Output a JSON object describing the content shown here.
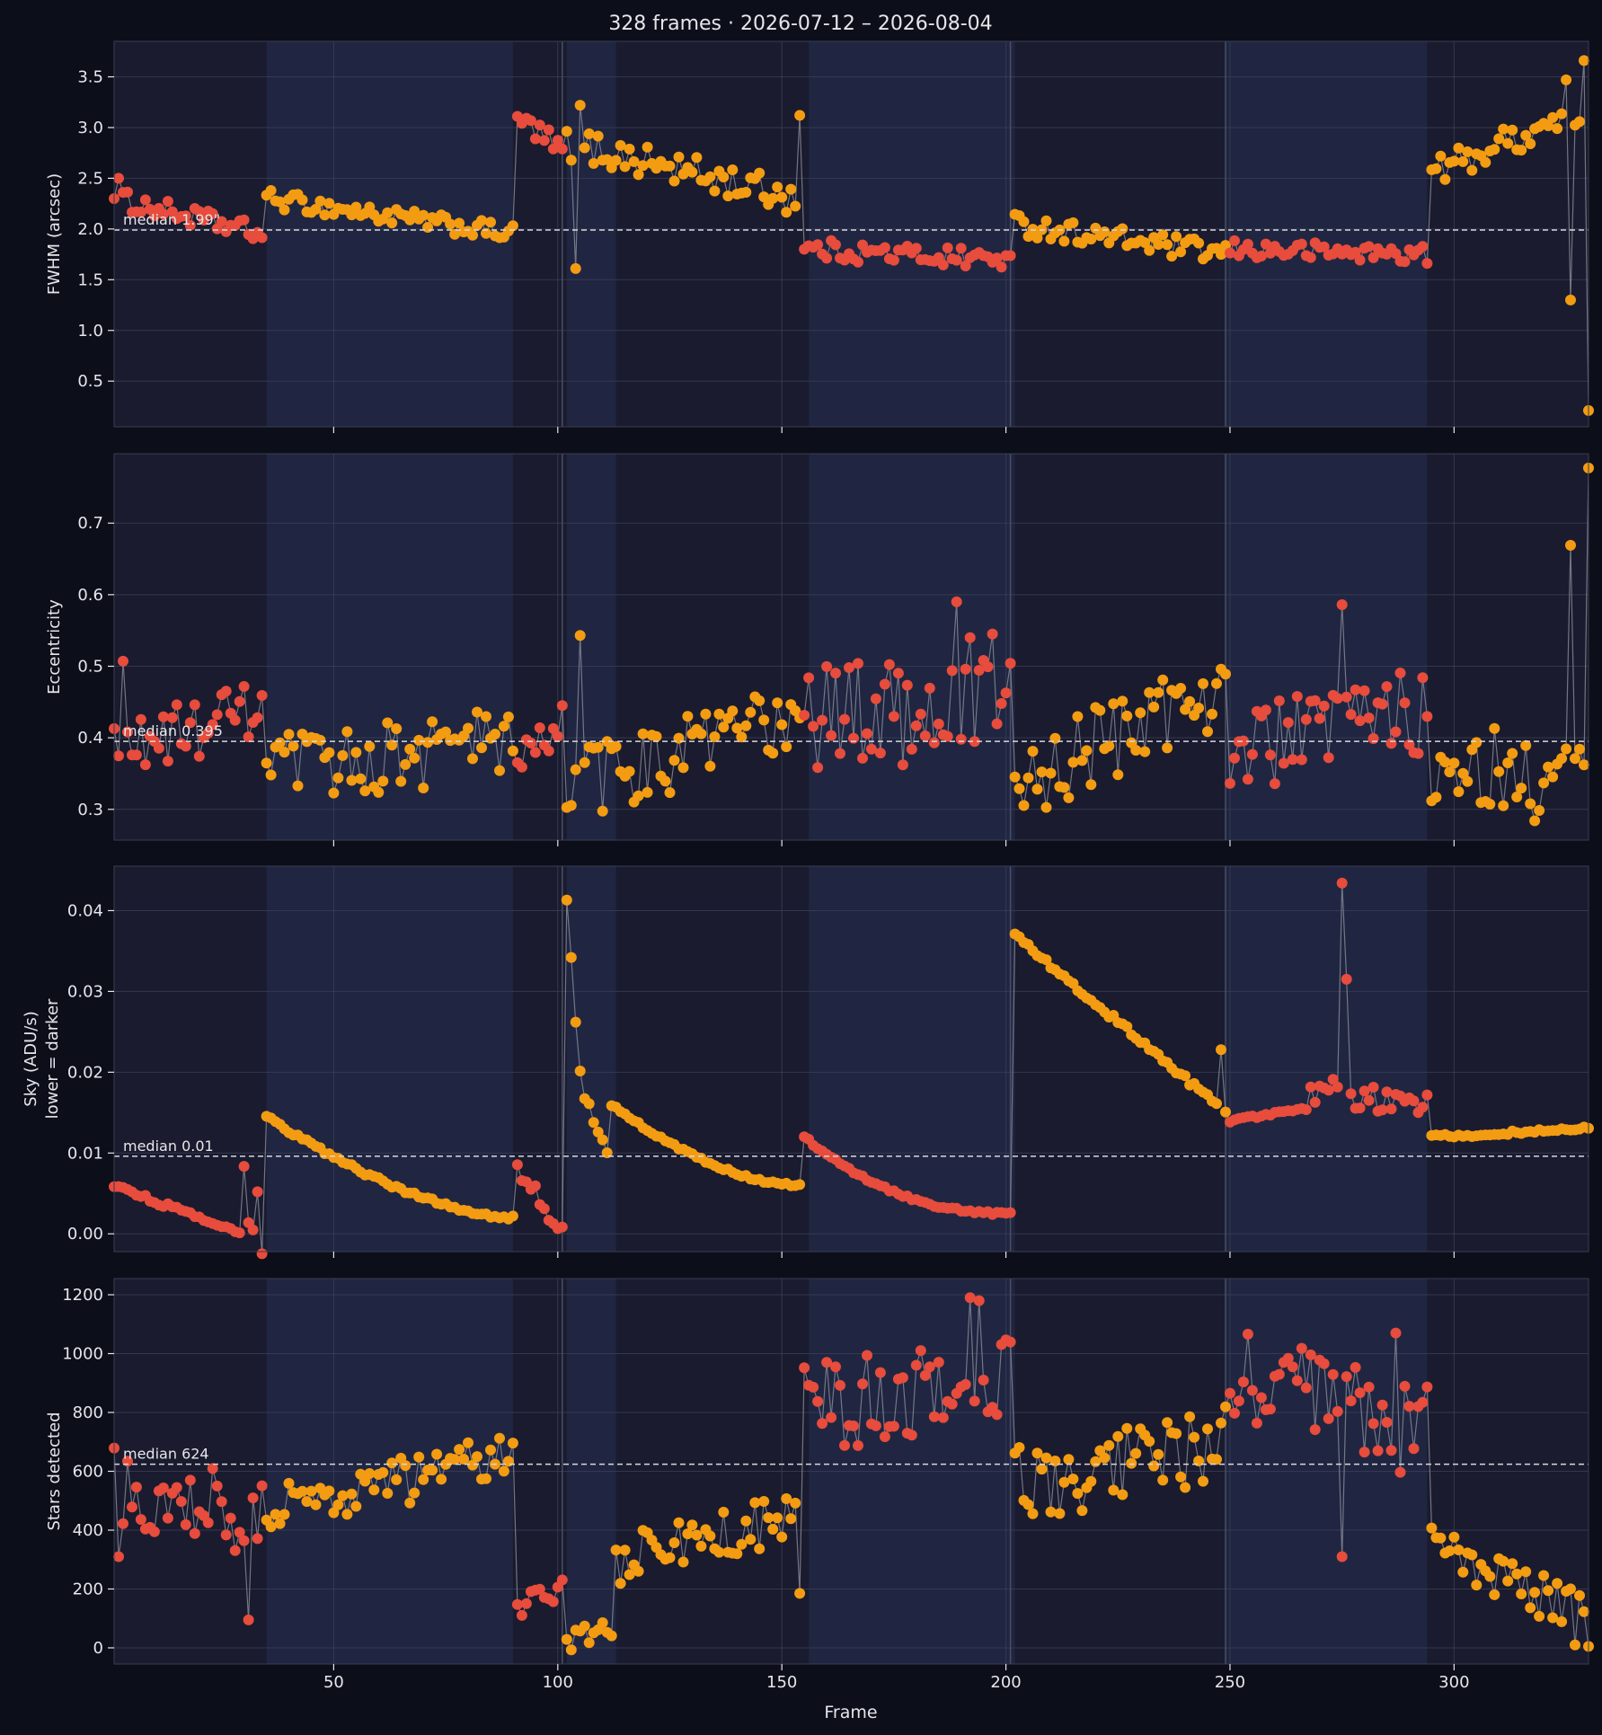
{
  "title": "328 frames · 2026-07-12 – 2026-08-04",
  "colors": {
    "background": "#0c0e1a",
    "panel": "#1a1b2e",
    "band": "#202641",
    "text": "#e6e6ea",
    "grid": "#3b3f55",
    "line": "#8a8c98",
    "good": "#f39c12",
    "bad": "#e74c3c",
    "median": "#d8d8de"
  },
  "chart_data": {
    "type": "scatter",
    "xlabel": "Frame",
    "xlim": [
      1,
      330
    ],
    "xticks": [
      50,
      100,
      150,
      200,
      250,
      300
    ],
    "bands": [
      [
        35,
        90
      ],
      [
        102,
        113
      ],
      [
        156,
        202
      ],
      [
        249,
        294
      ]
    ],
    "vlines": [
      101,
      201,
      249
    ],
    "panels": [
      {
        "id": "fwhm",
        "ylabel": [
          "FWHM (arcsec)"
        ],
        "ylim": [
          0.05,
          3.85
        ],
        "yticks": [
          0.5,
          1.0,
          1.5,
          2.0,
          2.5,
          3.0,
          3.5
        ],
        "tick_format": "f1",
        "median": 1.99,
        "median_label": "median 1.99\"",
        "segments": [
          {
            "x0": 1,
            "x1": 34,
            "start": 2.3,
            "end": 1.95,
            "noise": 0.17,
            "status": "bad"
          },
          {
            "x0": 35,
            "x1": 90,
            "start": 2.3,
            "end": 1.95,
            "noise": 0.15,
            "status": "good"
          },
          {
            "x0": 91,
            "x1": 101,
            "start": 3.1,
            "end": 2.75,
            "noise": 0.22,
            "status": "bad"
          },
          {
            "x0": 102,
            "x1": 154,
            "start": 2.85,
            "end": 2.3,
            "noise": 0.28,
            "status": "good"
          },
          {
            "x0": 155,
            "x1": 201,
            "start": 1.8,
            "end": 1.7,
            "noise": 0.17,
            "status": "bad"
          },
          {
            "x0": 202,
            "x1": 249,
            "start": 2.05,
            "end": 1.75,
            "noise": 0.18,
            "status": "good"
          },
          {
            "x0": 250,
            "x1": 294,
            "start": 1.8,
            "end": 1.75,
            "noise": 0.15,
            "status": "bad"
          },
          {
            "x0": 295,
            "x1": 330,
            "start": 2.55,
            "end": 3.2,
            "noise": 0.25,
            "status": "good"
          }
        ],
        "points": [
          {
            "x": 1,
            "y": 2.3,
            "status": "bad"
          },
          {
            "x": 2,
            "y": 2.5,
            "status": "bad"
          },
          {
            "x": 104,
            "y": 1.61,
            "status": "good"
          },
          {
            "x": 105,
            "y": 3.22,
            "status": "good"
          },
          {
            "x": 154,
            "y": 3.12,
            "status": "good"
          },
          {
            "x": 325,
            "y": 3.47,
            "status": "good"
          },
          {
            "x": 326,
            "y": 1.3,
            "status": "good"
          },
          {
            "x": 329,
            "y": 3.66,
            "status": "good"
          },
          {
            "x": 330,
            "y": 0.21,
            "status": "good"
          }
        ]
      },
      {
        "id": "ecc",
        "ylabel": [
          "Eccentricity"
        ],
        "ylim": [
          0.257,
          0.797
        ],
        "yticks": [
          0.3,
          0.4,
          0.5,
          0.6,
          0.7
        ],
        "tick_format": "f1",
        "median": 0.395,
        "median_label": "median 0.395",
        "segments": [
          {
            "x0": 1,
            "x1": 34,
            "start": 0.38,
            "end": 0.44,
            "noise": 0.07,
            "status": "bad"
          },
          {
            "x0": 35,
            "x1": 90,
            "start": 0.35,
            "end": 0.4,
            "noise": 0.09,
            "status": "good"
          },
          {
            "x0": 91,
            "x1": 101,
            "start": 0.35,
            "end": 0.43,
            "noise": 0.06,
            "status": "bad"
          },
          {
            "x0": 102,
            "x1": 154,
            "start": 0.33,
            "end": 0.43,
            "noise": 0.09,
            "status": "good"
          },
          {
            "x0": 155,
            "x1": 201,
            "start": 0.42,
            "end": 0.47,
            "noise": 0.14,
            "status": "bad"
          },
          {
            "x0": 202,
            "x1": 249,
            "start": 0.33,
            "end": 0.48,
            "noise": 0.1,
            "status": "good"
          },
          {
            "x0": 250,
            "x1": 294,
            "start": 0.38,
            "end": 0.44,
            "noise": 0.1,
            "status": "bad"
          },
          {
            "x0": 295,
            "x1": 330,
            "start": 0.37,
            "end": 0.33,
            "noise": 0.1,
            "status": "good"
          }
        ],
        "points": [
          {
            "x": 3,
            "y": 0.507,
            "status": "bad"
          },
          {
            "x": 105,
            "y": 0.543,
            "status": "good"
          },
          {
            "x": 189,
            "y": 0.59,
            "status": "bad"
          },
          {
            "x": 275,
            "y": 0.586,
            "status": "bad"
          },
          {
            "x": 326,
            "y": 0.669,
            "status": "good"
          },
          {
            "x": 330,
            "y": 0.777,
            "status": "good"
          }
        ]
      },
      {
        "id": "sky",
        "ylabel": [
          "Sky (ADU/s)",
          "lower = darker"
        ],
        "ylim": [
          -0.0022,
          0.0455
        ],
        "yticks": [
          0.0,
          0.01,
          0.02,
          0.03,
          0.04
        ],
        "tick_format": "f2",
        "median": 0.0096,
        "median_label": "median 0.01",
        "segments": [
          {
            "x0": 1,
            "x1": 29,
            "start": 0.006,
            "end": 0.0,
            "noise": 0.0005,
            "status": "bad"
          },
          {
            "x0": 30,
            "x1": 34,
            "start": 0.005,
            "end": 0.001,
            "noise": 0.006,
            "status": "bad"
          },
          {
            "x0": 35,
            "x1": 90,
            "start": 0.0145,
            "end": 0.002,
            "noise": 0.0004,
            "status": "good",
            "curve": 0.4
          },
          {
            "x0": 91,
            "x1": 101,
            "start": 0.008,
            "end": 0.0,
            "noise": 0.002,
            "status": "bad"
          },
          {
            "x0": 102,
            "x1": 105,
            "start": 0.041,
            "end": 0.02,
            "noise": 0.001,
            "status": "good"
          },
          {
            "x0": 106,
            "x1": 111,
            "start": 0.017,
            "end": 0.01,
            "noise": 0.001,
            "status": "good"
          },
          {
            "x0": 112,
            "x1": 154,
            "start": 0.016,
            "end": 0.006,
            "noise": 0.0003,
            "status": "good",
            "curve": 0.5
          },
          {
            "x0": 155,
            "x1": 201,
            "start": 0.012,
            "end": 0.0025,
            "noise": 0.0003,
            "status": "bad",
            "curve": 0.8
          },
          {
            "x0": 202,
            "x1": 249,
            "start": 0.037,
            "end": 0.015,
            "noise": 0.0006,
            "status": "good"
          },
          {
            "x0": 250,
            "x1": 267,
            "start": 0.014,
            "end": 0.0155,
            "noise": 0.0003,
            "status": "bad"
          },
          {
            "x0": 268,
            "x1": 294,
            "start": 0.018,
            "end": 0.016,
            "noise": 0.003,
            "status": "bad"
          },
          {
            "x0": 295,
            "x1": 330,
            "start": 0.012,
            "end": 0.013,
            "noise": 0.0004,
            "status": "good"
          }
        ],
        "points": [
          {
            "x": 102,
            "y": 0.0413,
            "status": "good"
          },
          {
            "x": 103,
            "y": 0.0342,
            "status": "good"
          },
          {
            "x": 104,
            "y": 0.0262,
            "status": "good"
          },
          {
            "x": 202,
            "y": 0.0371,
            "status": "good"
          },
          {
            "x": 275,
            "y": 0.0434,
            "status": "bad"
          },
          {
            "x": 276,
            "y": 0.0315,
            "status": "bad"
          },
          {
            "x": 248,
            "y": 0.0228,
            "status": "good"
          }
        ]
      },
      {
        "id": "stars",
        "ylabel": [
          "Stars detected"
        ],
        "ylim": [
          -55,
          1255
        ],
        "yticks": [
          0,
          200,
          400,
          600,
          800,
          1000,
          1200
        ],
        "tick_format": "int",
        "median": 624,
        "median_label": "median 624",
        "segments": [
          {
            "x0": 1,
            "x1": 34,
            "start": 550,
            "end": 450,
            "noise": 230,
            "status": "bad"
          },
          {
            "x0": 35,
            "x1": 90,
            "start": 470,
            "end": 650,
            "noise": 140,
            "status": "good"
          },
          {
            "x0": 91,
            "x1": 101,
            "start": 140,
            "end": 200,
            "noise": 60,
            "status": "bad"
          },
          {
            "x0": 102,
            "x1": 112,
            "start": 20,
            "end": 70,
            "noise": 60,
            "status": "good"
          },
          {
            "x0": 113,
            "x1": 154,
            "start": 300,
            "end": 450,
            "noise": 160,
            "status": "good"
          },
          {
            "x0": 155,
            "x1": 201,
            "start": 800,
            "end": 950,
            "noise": 260,
            "status": "bad"
          },
          {
            "x0": 202,
            "x1": 249,
            "start": 550,
            "end": 700,
            "noise": 220,
            "status": "good"
          },
          {
            "x0": 250,
            "x1": 294,
            "start": 900,
            "end": 750,
            "noise": 300,
            "status": "bad"
          },
          {
            "x0": 295,
            "x1": 330,
            "start": 350,
            "end": 100,
            "noise": 130,
            "status": "good"
          }
        ],
        "points": [
          {
            "x": 2,
            "y": 310,
            "status": "bad"
          },
          {
            "x": 31,
            "y": 95,
            "status": "bad"
          },
          {
            "x": 154,
            "y": 185,
            "status": "good"
          },
          {
            "x": 192,
            "y": 1190,
            "status": "bad"
          },
          {
            "x": 194,
            "y": 1180,
            "status": "bad"
          },
          {
            "x": 275,
            "y": 310,
            "status": "bad"
          },
          {
            "x": 287,
            "y": 1070,
            "status": "bad"
          },
          {
            "x": 327,
            "y": 10,
            "status": "good"
          },
          {
            "x": 330,
            "y": 5,
            "status": "good"
          }
        ]
      }
    ]
  }
}
